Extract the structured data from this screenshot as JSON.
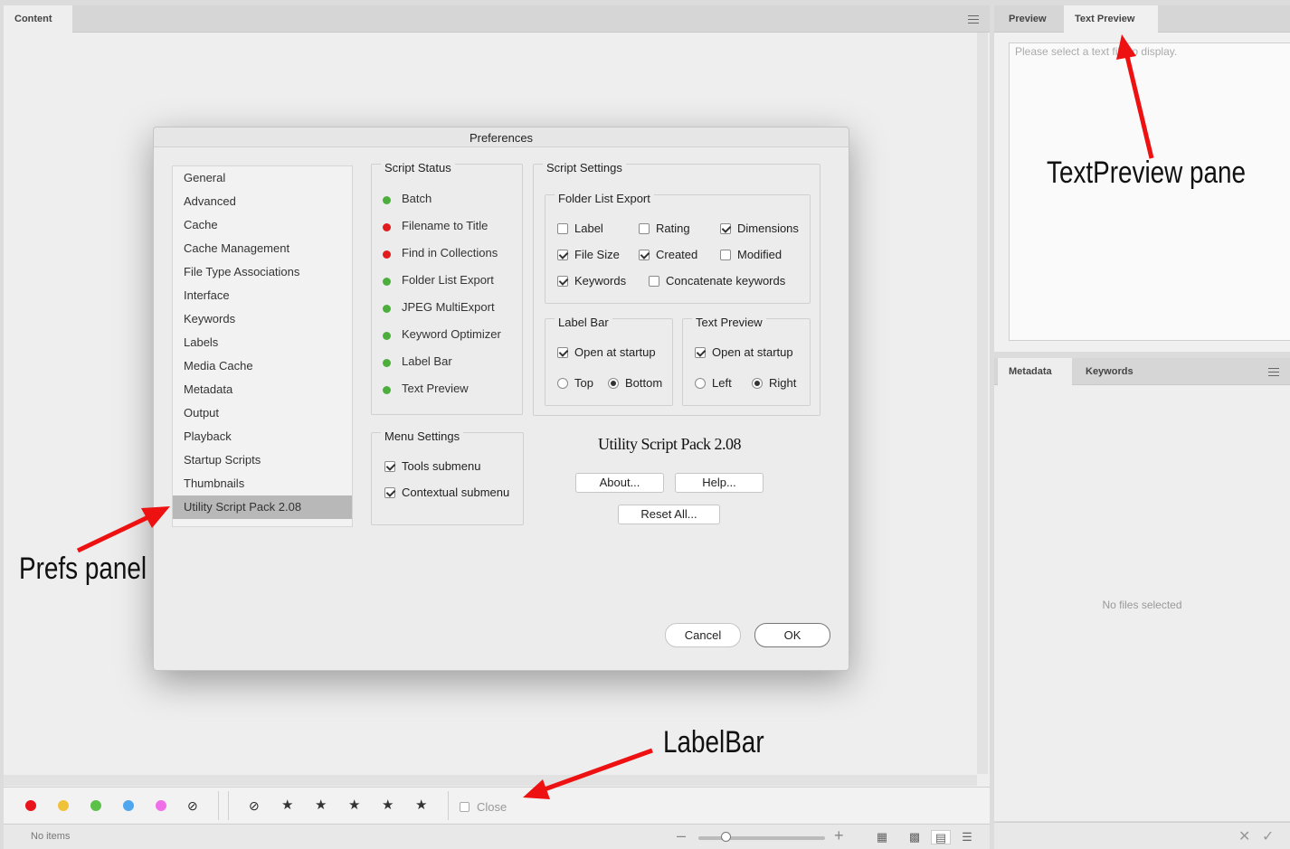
{
  "content_panel": {
    "tab": "Content",
    "filter_bar": {
      "colors": [
        "#e8131b",
        "#f0c23a",
        "#5cc14a",
        "#4ea6ee",
        "#f06fe8"
      ],
      "close_label": "Close"
    },
    "status_text": "No items"
  },
  "preview_panel": {
    "tabs": [
      "Preview",
      "Text Preview"
    ],
    "placeholder": "Please select a text file to display."
  },
  "metadata_panel": {
    "tabs": [
      "Metadata",
      "Keywords"
    ],
    "empty_text": "No files selected"
  },
  "dialog": {
    "title": "Preferences",
    "pref_items": [
      "General",
      "Advanced",
      "Cache",
      "Cache Management",
      "File Type Associations",
      "Interface",
      "Keywords",
      "Labels",
      "Media Cache",
      "Metadata",
      "Output",
      "Playback",
      "Startup Scripts",
      "Thumbnails",
      "Utility Script Pack 2.08"
    ],
    "selected_item": "Utility Script Pack 2.08",
    "script_status": {
      "title": "Script Status",
      "items": [
        {
          "label": "Batch",
          "color": "#4caf3c"
        },
        {
          "label": "Filename to Title",
          "color": "#e01c1c"
        },
        {
          "label": "Find in Collections",
          "color": "#e01c1c"
        },
        {
          "label": "Folder List Export",
          "color": "#4caf3c"
        },
        {
          "label": "JPEG MultiExport",
          "color": "#4caf3c"
        },
        {
          "label": "Keyword Optimizer",
          "color": "#4caf3c"
        },
        {
          "label": "Label Bar",
          "color": "#4caf3c"
        },
        {
          "label": "Text Preview",
          "color": "#4caf3c"
        }
      ]
    },
    "menu_settings": {
      "title": "Menu Settings",
      "tools_submenu": "Tools submenu",
      "contextual_submenu": "Contextual submenu"
    },
    "script_settings": {
      "title": "Script Settings",
      "folder_list_export": {
        "title": "Folder List Export",
        "label": "Label",
        "rating": "Rating",
        "dimensions": "Dimensions",
        "file_size": "File Size",
        "created": "Created",
        "modified": "Modified",
        "keywords": "Keywords",
        "concatenate": "Concatenate keywords"
      },
      "label_bar": {
        "title": "Label Bar",
        "open_at_startup": "Open at startup",
        "top": "Top",
        "bottom": "Bottom"
      },
      "text_preview": {
        "title": "Text Preview",
        "open_at_startup": "Open at startup",
        "left": "Left",
        "right": "Right"
      }
    },
    "pack_title": "Utility Script Pack 2.08",
    "about": "About...",
    "help": "Help...",
    "reset_all": "Reset All...",
    "cancel": "Cancel",
    "ok": "OK"
  },
  "annotations": {
    "prefs_panel": "Prefs panel",
    "labelbar": "LabelBar",
    "textpreview_pane": "TextPreview pane",
    "arrow_color": "#ee1111"
  }
}
